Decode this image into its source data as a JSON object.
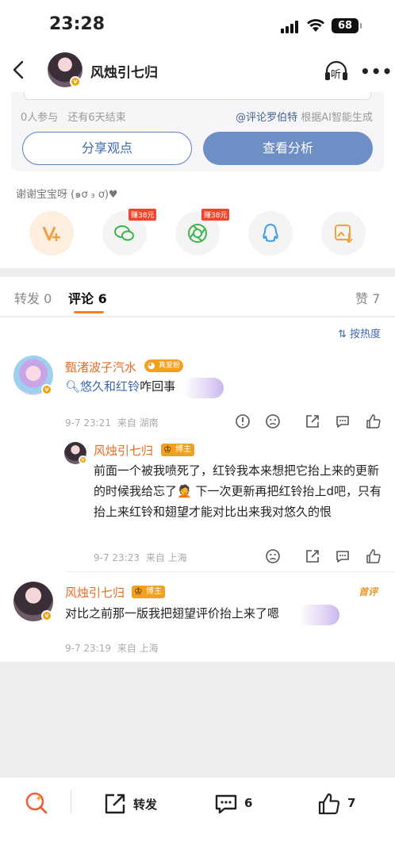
{
  "status_bar": {
    "time": "23:28",
    "battery": "68"
  },
  "header": {
    "title": "风烛引七归",
    "listen_label": "听"
  },
  "poll": {
    "participants": "0人参与",
    "remaining": "还有6天结束",
    "credit_link": "@评论罗伯特",
    "credit_suffix": "根据AI智能生成",
    "share_button": "分享观点",
    "analyze_button": "查看分析"
  },
  "thanks_text": "谢谢宝宝呀 (๑ơ ₃ ơ)♥",
  "share_targets": [
    {
      "name": "vplus",
      "earn": ""
    },
    {
      "name": "wechat",
      "earn": "赚38元"
    },
    {
      "name": "moments",
      "earn": "赚38元"
    },
    {
      "name": "qq",
      "earn": ""
    },
    {
      "name": "save-image",
      "earn": ""
    }
  ],
  "tabs": {
    "repost": "转发 0",
    "comments": "评论 6",
    "likes": "赞 7"
  },
  "sort_label": "按热度",
  "comments": [
    {
      "author": "甄渚波子汽水",
      "badge": "真爱粉",
      "link_text": "悠久和红铃",
      "text": "咋回事",
      "time": "9-7 23:21",
      "source": "来自 湖南",
      "reply": {
        "author": "风烛引七归",
        "badge": "博主",
        "text": "前面一个被我喷死了，红铃我本来想把它抬上来的更新的时候我给忘了🤦 下一次更新再把红铃抬上d吧，只有抬上来红铃和翅望才能对比出来我对悠久的恨",
        "time": "9-7 23:23",
        "source": "来自 上海"
      }
    },
    {
      "author": "风烛引七归",
      "badge": "博主",
      "tag": "首评",
      "text": "对比之前那一版我把翅望评价抬上来了嗯",
      "time": "9-7 23:19",
      "source": "来自 上海"
    }
  ],
  "bottom_bar": {
    "repost": "转发",
    "comments_count": "6",
    "likes_count": "7"
  },
  "colors": {
    "accent_orange": "#f6821f",
    "link_blue": "#3d68b1",
    "name_orange": "#e86b22"
  }
}
